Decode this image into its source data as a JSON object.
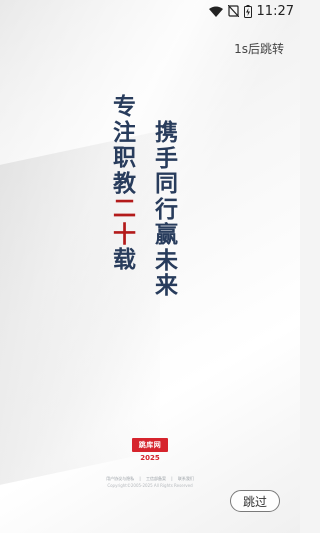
{
  "status_bar": {
    "time": "11:27",
    "icons": [
      "wifi-icon",
      "no-sim-icon",
      "battery-charging-icon"
    ]
  },
  "countdown": {
    "label": "1s后跳转"
  },
  "slogan": {
    "left_column": [
      "专",
      "注",
      "职",
      "教",
      "二",
      "十",
      "载"
    ],
    "right_column": [
      "携",
      "手",
      "同",
      "行",
      "赢",
      "未",
      "来"
    ],
    "accent_color": "#b31a1a",
    "text_color": "#283c5c"
  },
  "brand": {
    "logo_text": "跳库网",
    "year": "2025",
    "brand_color": "#d6242d"
  },
  "footer": {
    "links": [
      "用户协议与隐私",
      "工信部备案",
      "联系我们"
    ],
    "copyright": "Copyright©2005-2025 All Rights Reserved"
  },
  "skip_button": {
    "label": "跳过"
  }
}
